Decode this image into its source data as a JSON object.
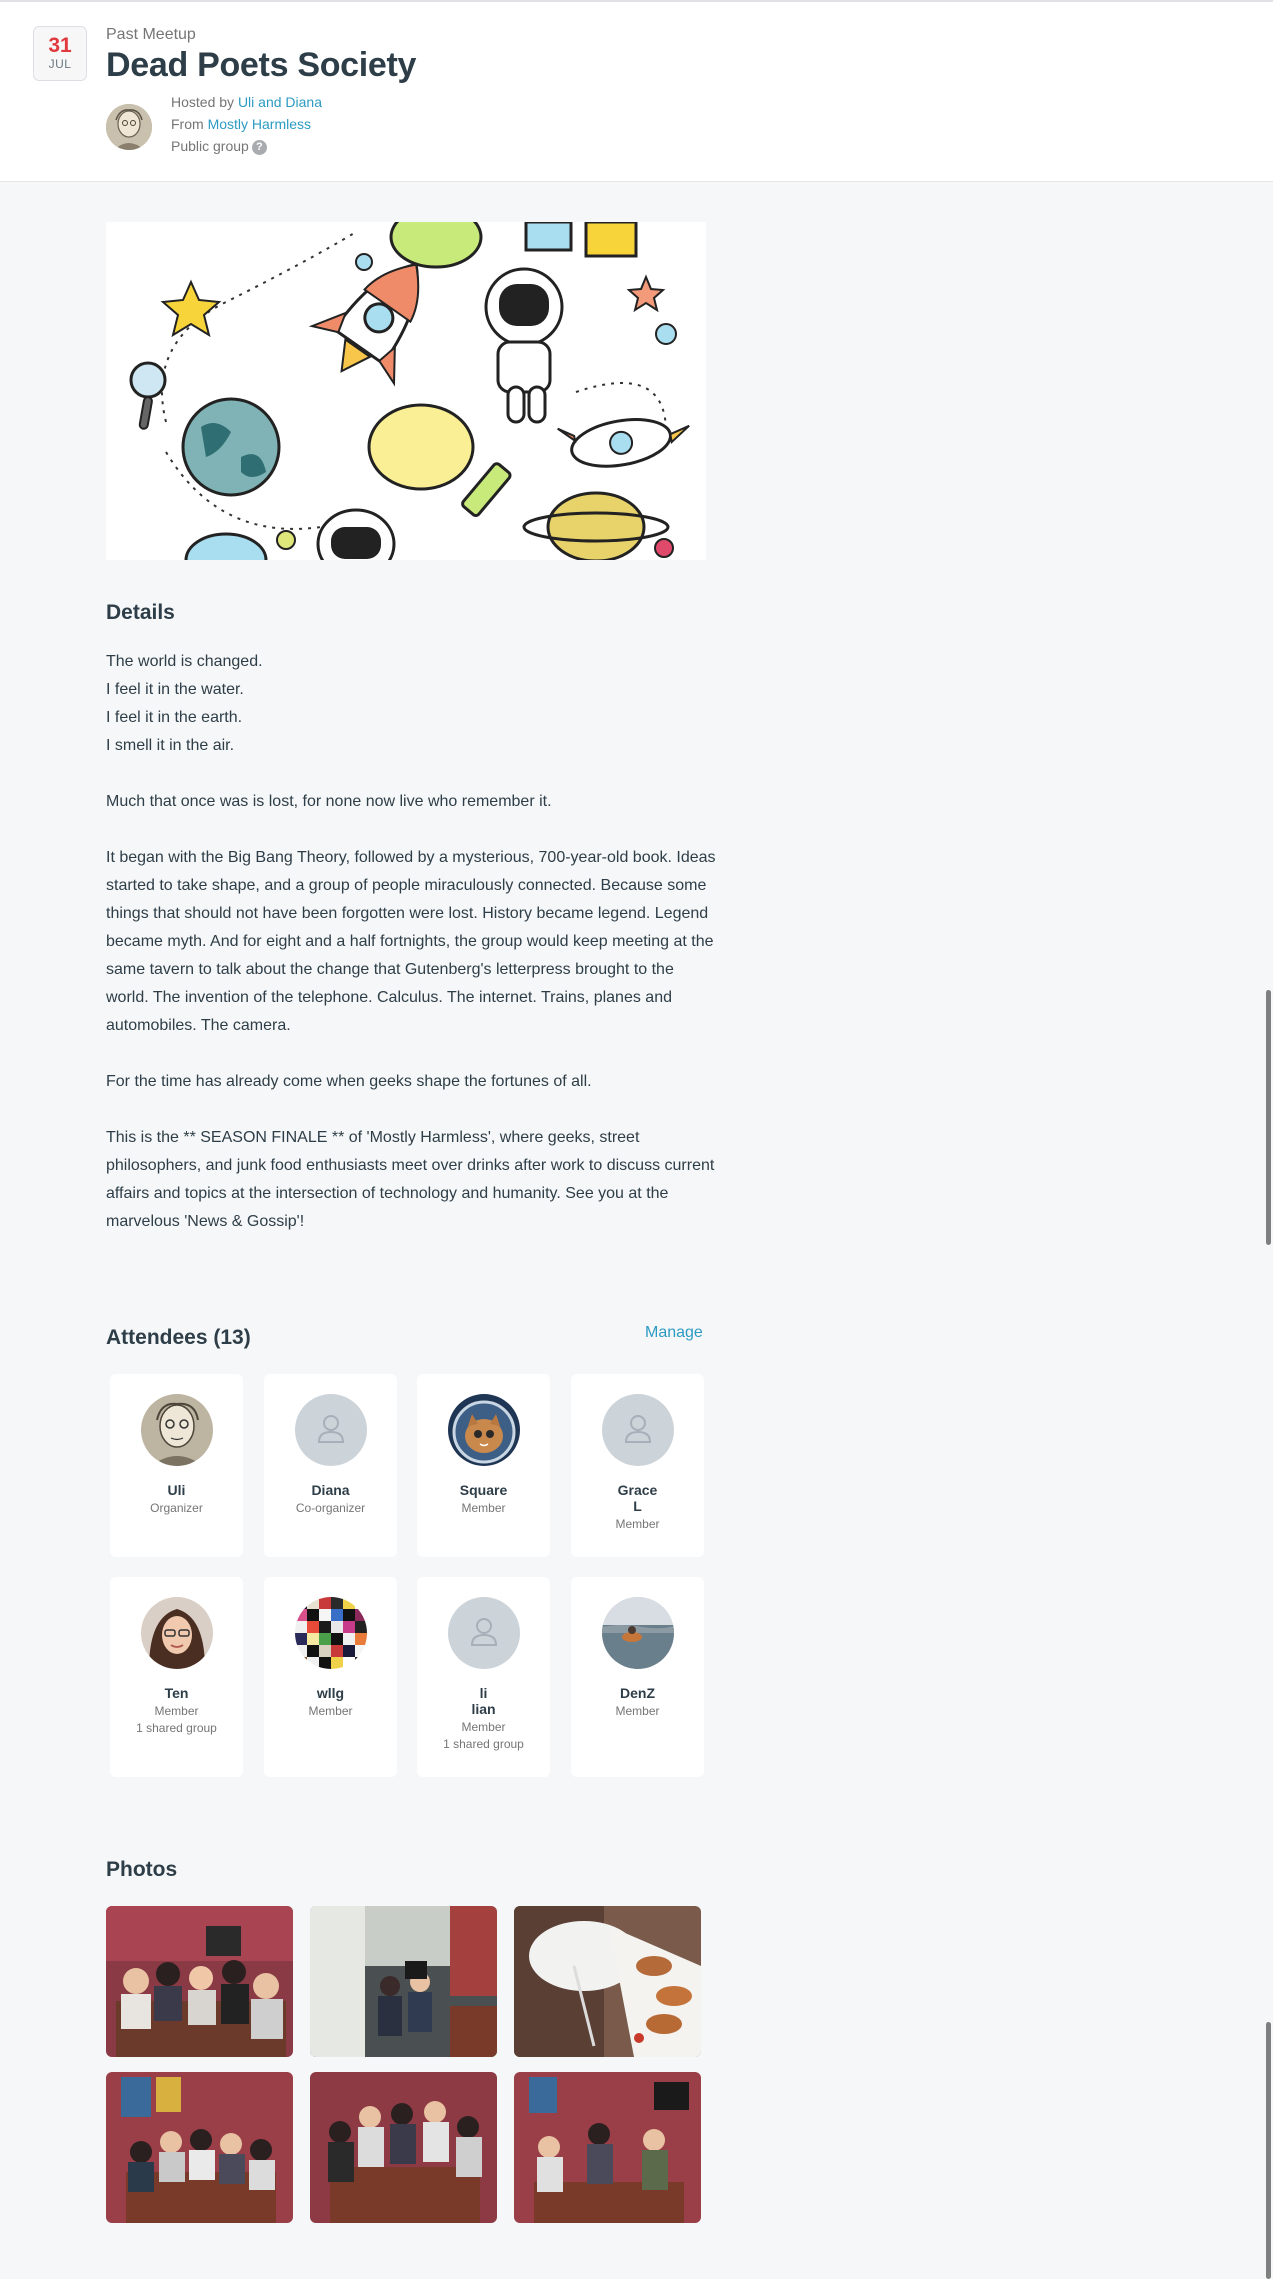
{
  "event": {
    "date_day": "31",
    "date_month": "JUL",
    "status": "Past Meetup",
    "title": "Dead Poets Society",
    "hosted_prefix": "Hosted by",
    "hosts": "Uli and Diana",
    "from_prefix": "From",
    "group": "Mostly Harmless",
    "group_type": "Public group",
    "help_glyph": "?"
  },
  "details": {
    "heading": "Details",
    "paragraphs": [
      "The world is changed.\nI feel it in the water.\nI feel it in the earth.\nI smell it in the air.",
      "Much that once was is lost, for none now live who remember it.",
      "It began with the Big Bang Theory, followed by a mysterious, 700-year-old book. Ideas started to take shape, and a group of people miraculously connected. Because some things that should not have been forgotten were lost. History became legend. Legend became myth. And for eight and a half fortnights, the group would keep meeting at the same tavern to talk about the change that Gutenberg's letterpress brought to the world. The invention of the telephone. Calculus. The internet. Trains, planes and automobiles. The camera.",
      "For the time has already come when geeks shape the fortunes of all.",
      "This is the ** SEASON FINALE ** of 'Mostly Harmless', where geeks, street philosophers, and junk food enthusiasts meet over drinks after work to discuss current affairs and topics at the intersection of technology and humanity. See you at the marvelous 'News & Gossip'!"
    ]
  },
  "attendees": {
    "heading": "Attendees (13)",
    "manage_label": "Manage",
    "list": [
      {
        "name": "Uli",
        "role": "Organizer",
        "extra": "",
        "avatar": "photo-sketch"
      },
      {
        "name": "Diana",
        "role": "Co-organizer",
        "extra": "",
        "avatar": "placeholder"
      },
      {
        "name": "Square",
        "role": "Member",
        "extra": "",
        "avatar": "photo-cat"
      },
      {
        "name": "Grace\nL",
        "role": "Member",
        "extra": "",
        "avatar": "placeholder"
      },
      {
        "name": "Ten",
        "role": "Member",
        "extra": "1 shared group",
        "avatar": "photo-woman"
      },
      {
        "name": "wllg",
        "role": "Member",
        "extra": "",
        "avatar": "photo-pixels"
      },
      {
        "name": "li\nlian",
        "role": "Member",
        "extra": "1 shared group",
        "avatar": "placeholder"
      },
      {
        "name": "DenZ",
        "role": "Member",
        "extra": "",
        "avatar": "photo-sea"
      }
    ]
  },
  "photos": {
    "heading": "Photos",
    "count": 6
  },
  "colors": {
    "accent_link": "#2c9bc3",
    "date_red": "#e0393e",
    "text_dark": "#2e3e48",
    "page_bg": "#f6f7f8"
  }
}
